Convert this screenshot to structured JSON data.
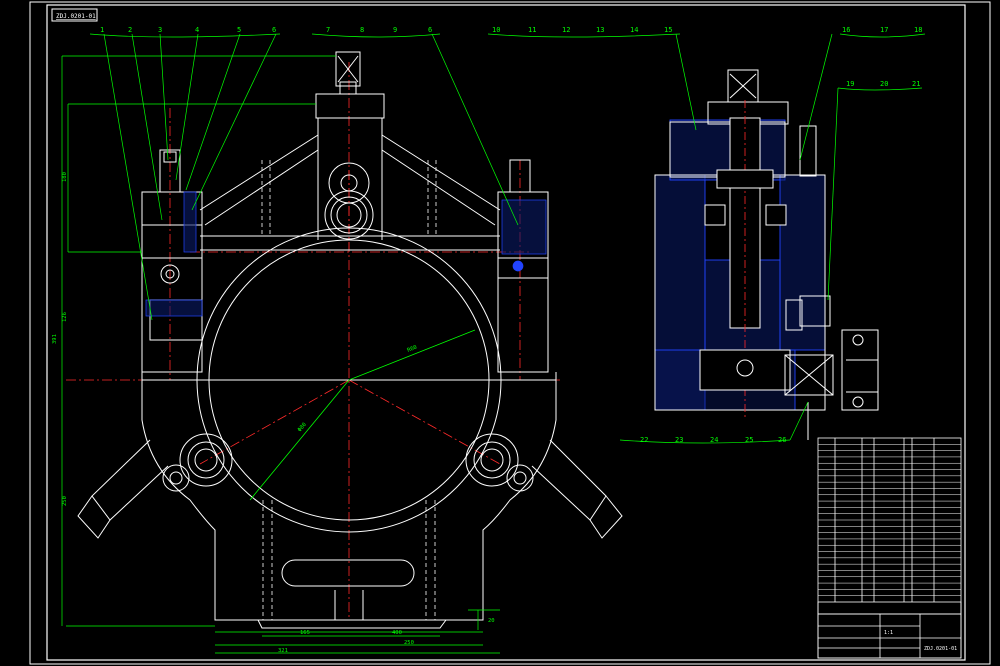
{
  "drawing": {
    "stamp_text": "ZDJ.0201-01",
    "background": "#000000",
    "line_color": "#ffffff",
    "leader_color": "#00ff00",
    "center_color": "#ff2a2a",
    "hatch_color": "#2244ff",
    "dimension_text_color": "#00ff00"
  },
  "left_view": {
    "balloons": [
      "1",
      "2",
      "3",
      "4",
      "5",
      "6",
      "7",
      "8",
      "9",
      "6"
    ],
    "dims": {
      "overall_height": "391",
      "upper_height": "180",
      "mid_height": "126",
      "lower_height": "250",
      "radius": "R60",
      "diameter": "Φ80",
      "base_length": "400",
      "width_1": "250",
      "width_2": "321",
      "width_3": "165",
      "stand_height": "20"
    }
  },
  "right_view": {
    "top_balloons": [
      "10",
      "11",
      "12",
      "13",
      "14",
      "15",
      "16",
      "17",
      "18"
    ],
    "side_balloons": [
      "19",
      "20",
      "21"
    ],
    "bottom_balloons": [
      "22",
      "23",
      "24",
      "25",
      "26"
    ]
  },
  "title_block": {
    "drawing_number": "ZDJ.0201-01",
    "scale_label": "1:1"
  }
}
